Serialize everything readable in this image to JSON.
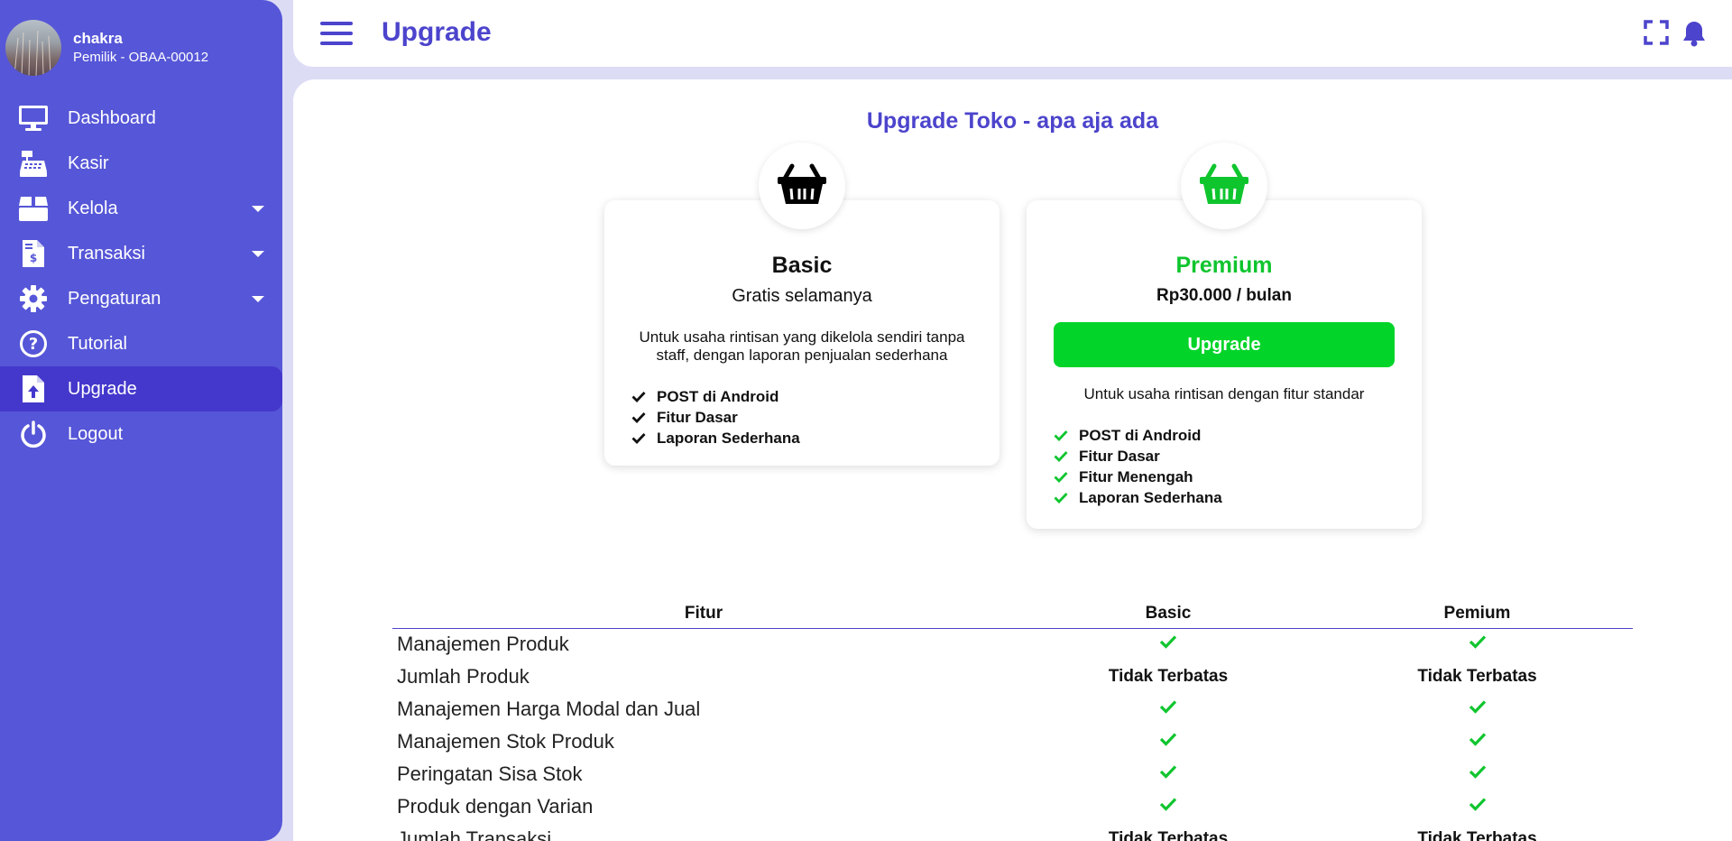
{
  "user": {
    "name": "chakra",
    "role": "Pemilik - OBAA-00012"
  },
  "sidebar": {
    "items": [
      {
        "label": "Dashboard",
        "icon": "monitor-icon"
      },
      {
        "label": "Kasir",
        "icon": "cash-register-icon"
      },
      {
        "label": "Kelola",
        "icon": "box-icon"
      },
      {
        "label": "Transaksi",
        "icon": "invoice-icon"
      },
      {
        "label": "Pengaturan",
        "icon": "gear-icon"
      },
      {
        "label": "Tutorial",
        "icon": "question-icon"
      },
      {
        "label": "Upgrade",
        "icon": "file-upload-icon"
      },
      {
        "label": "Logout",
        "icon": "power-icon"
      }
    ]
  },
  "header": {
    "title": "Upgrade"
  },
  "main": {
    "heading": "Upgrade Toko - apa aja ada",
    "basic": {
      "name": "Basic",
      "price": "Gratis selamanya",
      "desc": "Untuk usaha rintisan yang dikelola sendiri tanpa staff, dengan laporan penjualan sederhana",
      "features": [
        "POST di Android",
        "Fitur Dasar",
        "Laporan Sederhana"
      ]
    },
    "premium": {
      "name": "Premium",
      "price": "Rp30.000 / bulan",
      "button": "Upgrade",
      "desc": "Untuk usaha rintisan dengan fitur standar",
      "features": [
        "POST di Android",
        "Fitur Dasar",
        "Fitur Menengah",
        "Laporan Sederhana"
      ]
    },
    "table": {
      "headers": [
        "Fitur",
        "Basic",
        "Pemium"
      ],
      "rows": [
        {
          "feature": "Manajemen Produk",
          "basic": "check",
          "premium": "check"
        },
        {
          "feature": "Jumlah Produk",
          "basic": "Tidak Terbatas",
          "premium": "Tidak Terbatas"
        },
        {
          "feature": "Manajemen Harga Modal dan Jual",
          "basic": "check",
          "premium": "check"
        },
        {
          "feature": "Manajemen Stok Produk",
          "basic": "check",
          "premium": "check"
        },
        {
          "feature": "Peringatan Sisa Stok",
          "basic": "check",
          "premium": "check"
        },
        {
          "feature": "Produk dengan Varian",
          "basic": "check",
          "premium": "check"
        },
        {
          "feature": "Jumlah Transaksi",
          "basic": "Tidak Terbatas",
          "premium": "Tidak Terbatas"
        }
      ]
    }
  },
  "colors": {
    "primary": "#5656d8",
    "accent": "#4c44cc",
    "green": "#03d42a"
  }
}
